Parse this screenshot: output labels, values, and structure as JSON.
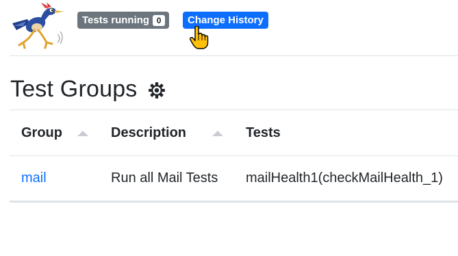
{
  "header": {
    "running_label": "Tests running",
    "running_count": "0",
    "change_history_label": "Change History"
  },
  "page": {
    "title": "Test Groups"
  },
  "table": {
    "columns": [
      "Group",
      "Description",
      "Tests"
    ],
    "rows": [
      {
        "group": "mail",
        "description": "Run all Mail Tests",
        "tests": "mailHealth1(checkMailHealth_1)"
      }
    ]
  },
  "colors": {
    "primary": "#0d6efd",
    "secondary": "#6c757d",
    "border": "#dee2e6",
    "text": "#212529"
  },
  "icons": {
    "logo": "roadrunner-logo",
    "settings": "gear-icon",
    "cursor": "hand-pointer-cursor",
    "sort": "sort-up-triangle"
  }
}
